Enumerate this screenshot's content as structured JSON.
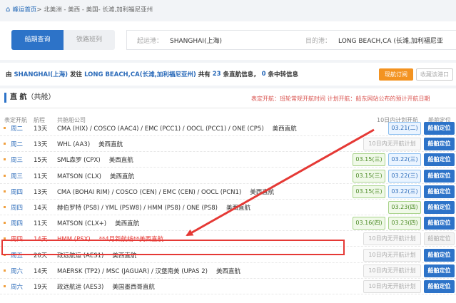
{
  "breadcrumb": {
    "home": "峰运首页",
    "path": " > 北美洲 - 美西 - 美国- 长滩,加利福尼亚州"
  },
  "tabs": {
    "active": "船期查询",
    "inactive": "铁路班列"
  },
  "search": {
    "from_label": "起运港：",
    "from_value": "SHANGHAI(上海)",
    "to_label": "目的港：",
    "to_value": "LONG BEACH,CA (长滩,加利福尼亚"
  },
  "summary": {
    "p1": "由",
    "from": "SHANGHAI(上海)",
    "p2": "发往",
    "to": "LONG BEACH,CA(长滩,加利福尼亚州)",
    "p3": "共有",
    "direct": "23",
    "p4": "条直航信息，",
    "transfer": "0",
    "p5": "条中转信息",
    "subscribe": "现航订阅",
    "stop_notice": "收藏该港口"
  },
  "section": {
    "title": "直 航",
    "sub": "（共舱）",
    "note": "表定开航：班轮常规开航时间    计划开航：船东网站公布的预计开航日期"
  },
  "columns": {
    "day": "表定开航",
    "dur": "航程",
    "lines": "共舱船公司",
    "plan": "10日内计划开航",
    "locate": "船舶定位"
  },
  "rows": [
    {
      "day": "周二",
      "dur": "13天",
      "lines": "CMA (HIX) / COSCO (AAC4) / EMC (PCC1) / OOCL (PCC1) / ONE (CP5)",
      "tag": "美西直航",
      "plan": [
        {
          "t": "03.21(二)",
          "c": "blue"
        }
      ],
      "locate": "船舶定位"
    },
    {
      "day": "周二",
      "dur": "13天",
      "lines": "WHL (AA3)",
      "tag": "美西直航",
      "plan": [
        {
          "t": "10日内无开航计划",
          "c": "gray"
        }
      ],
      "locate": "船舶定位"
    },
    {
      "day": "周三",
      "dur": "15天",
      "lines": "SML森罗 (CPX)",
      "tag": "美西直航",
      "plan": [
        {
          "t": "03.15(三)",
          "c": "green"
        },
        {
          "t": "03.22(三)",
          "c": "blue"
        }
      ],
      "locate": "船舶定位"
    },
    {
      "day": "周三",
      "dur": "11天",
      "lines": "MATSON (CLX)",
      "tag": "美西直航",
      "plan": [
        {
          "t": "03.15(三)",
          "c": "green"
        },
        {
          "t": "03.22(三)",
          "c": "blue"
        }
      ],
      "locate": "船舶定位"
    },
    {
      "day": "周四",
      "dur": "13天",
      "lines": "CMA (BOHAI RIM) / COSCO (CEN) / EMC (CEN) / OOCL (PCN1)",
      "tag": "美西直航",
      "plan": [
        {
          "t": "03.15(三)",
          "c": "green"
        },
        {
          "t": "03.22(三)",
          "c": "blue"
        }
      ],
      "locate": "船舶定位"
    },
    {
      "day": "周四",
      "dur": "14天",
      "lines": "赫伯罗特 (PS8) / YML (PSW8) / HMM (PS8) / ONE (PS8)",
      "tag": "美西直航",
      "plan": [
        {
          "t": "03.23(四)",
          "c": "green"
        }
      ],
      "locate": "船舶定位"
    },
    {
      "day": "周四",
      "dur": "11天",
      "lines": "MATSON (CLX+)",
      "tag": "美西直航",
      "plan": [
        {
          "t": "03.16(四)",
          "c": "green"
        },
        {
          "t": "03.23(四)",
          "c": "green"
        }
      ],
      "locate": "船舶定位"
    },
    {
      "day": "周四",
      "dur": "14天",
      "lines": "HMM (PSX)",
      "tag": "**4月新航线**美西直航",
      "plan": [
        {
          "t": "10日内无开航计划",
          "c": "gray"
        }
      ],
      "locate": "船舶定位",
      "disabled": true
    },
    {
      "day": "周五",
      "dur": "20天",
      "lines": "政远航运 (AES1)",
      "tag": "美西直航",
      "plan": [
        {
          "t": "10日内无开航计划",
          "c": "gray"
        }
      ],
      "locate": "船舶定位"
    },
    {
      "day": "周六",
      "dur": "14天",
      "lines": "MAERSK (TP2) / MSC (JAGUAR) / 汉堡南美 (UPAS 2)",
      "tag": "美西直航",
      "plan": [
        {
          "t": "10日内无开航计划",
          "c": "gray"
        }
      ],
      "locate": "船舶定位"
    },
    {
      "day": "周六",
      "dur": "19天",
      "lines": "政远航运 (AES3)",
      "tag": "美国墨西哥直航",
      "plan": [
        {
          "t": "10日内无开航计划",
          "c": "gray"
        }
      ],
      "locate": "船舶定位"
    }
  ],
  "colors": {
    "primary": "#2d73c8",
    "accent": "#f39321",
    "highlight": "#e53935"
  }
}
